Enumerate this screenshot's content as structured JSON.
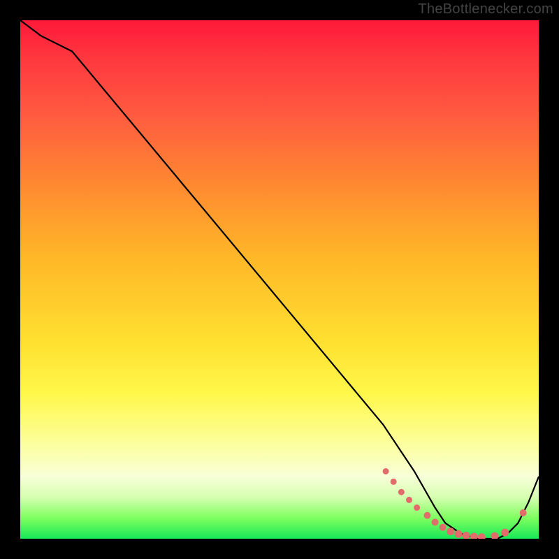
{
  "watermark": "TheBottlenecker.com",
  "chart_data": {
    "type": "line",
    "title": "",
    "xlabel": "",
    "ylabel": "",
    "xlim": [
      0,
      100
    ],
    "ylim": [
      0,
      100
    ],
    "series": [
      {
        "name": "curve",
        "x": [
          0,
          4,
          10,
          20,
          30,
          40,
          50,
          60,
          70,
          76,
          80,
          82,
          85,
          88,
          90,
          92,
          94,
          96,
          98,
          100
        ],
        "y": [
          100,
          97,
          94,
          82,
          70,
          58,
          46,
          34,
          22,
          13,
          6,
          3,
          1,
          0,
          0,
          0,
          1,
          3,
          7,
          12
        ]
      }
    ],
    "markers": {
      "name": "highlight-dots",
      "x": [
        70.5,
        72,
        73.5,
        75,
        76.5,
        78.5,
        80,
        81.5,
        83,
        84.5,
        86,
        87.5,
        89,
        91.5,
        93.5,
        97
      ],
      "y": [
        13,
        11,
        9,
        7.5,
        6,
        4.5,
        3.2,
        2.2,
        1.4,
        0.9,
        0.6,
        0.4,
        0.3,
        0.5,
        1.2,
        5
      ],
      "color": "#e26b6b"
    },
    "colors": {
      "curve": "#000000",
      "background_top": "#ff1a3a",
      "background_bottom": "#18e858",
      "frame": "#000000",
      "marker": "#e26b6b"
    }
  }
}
